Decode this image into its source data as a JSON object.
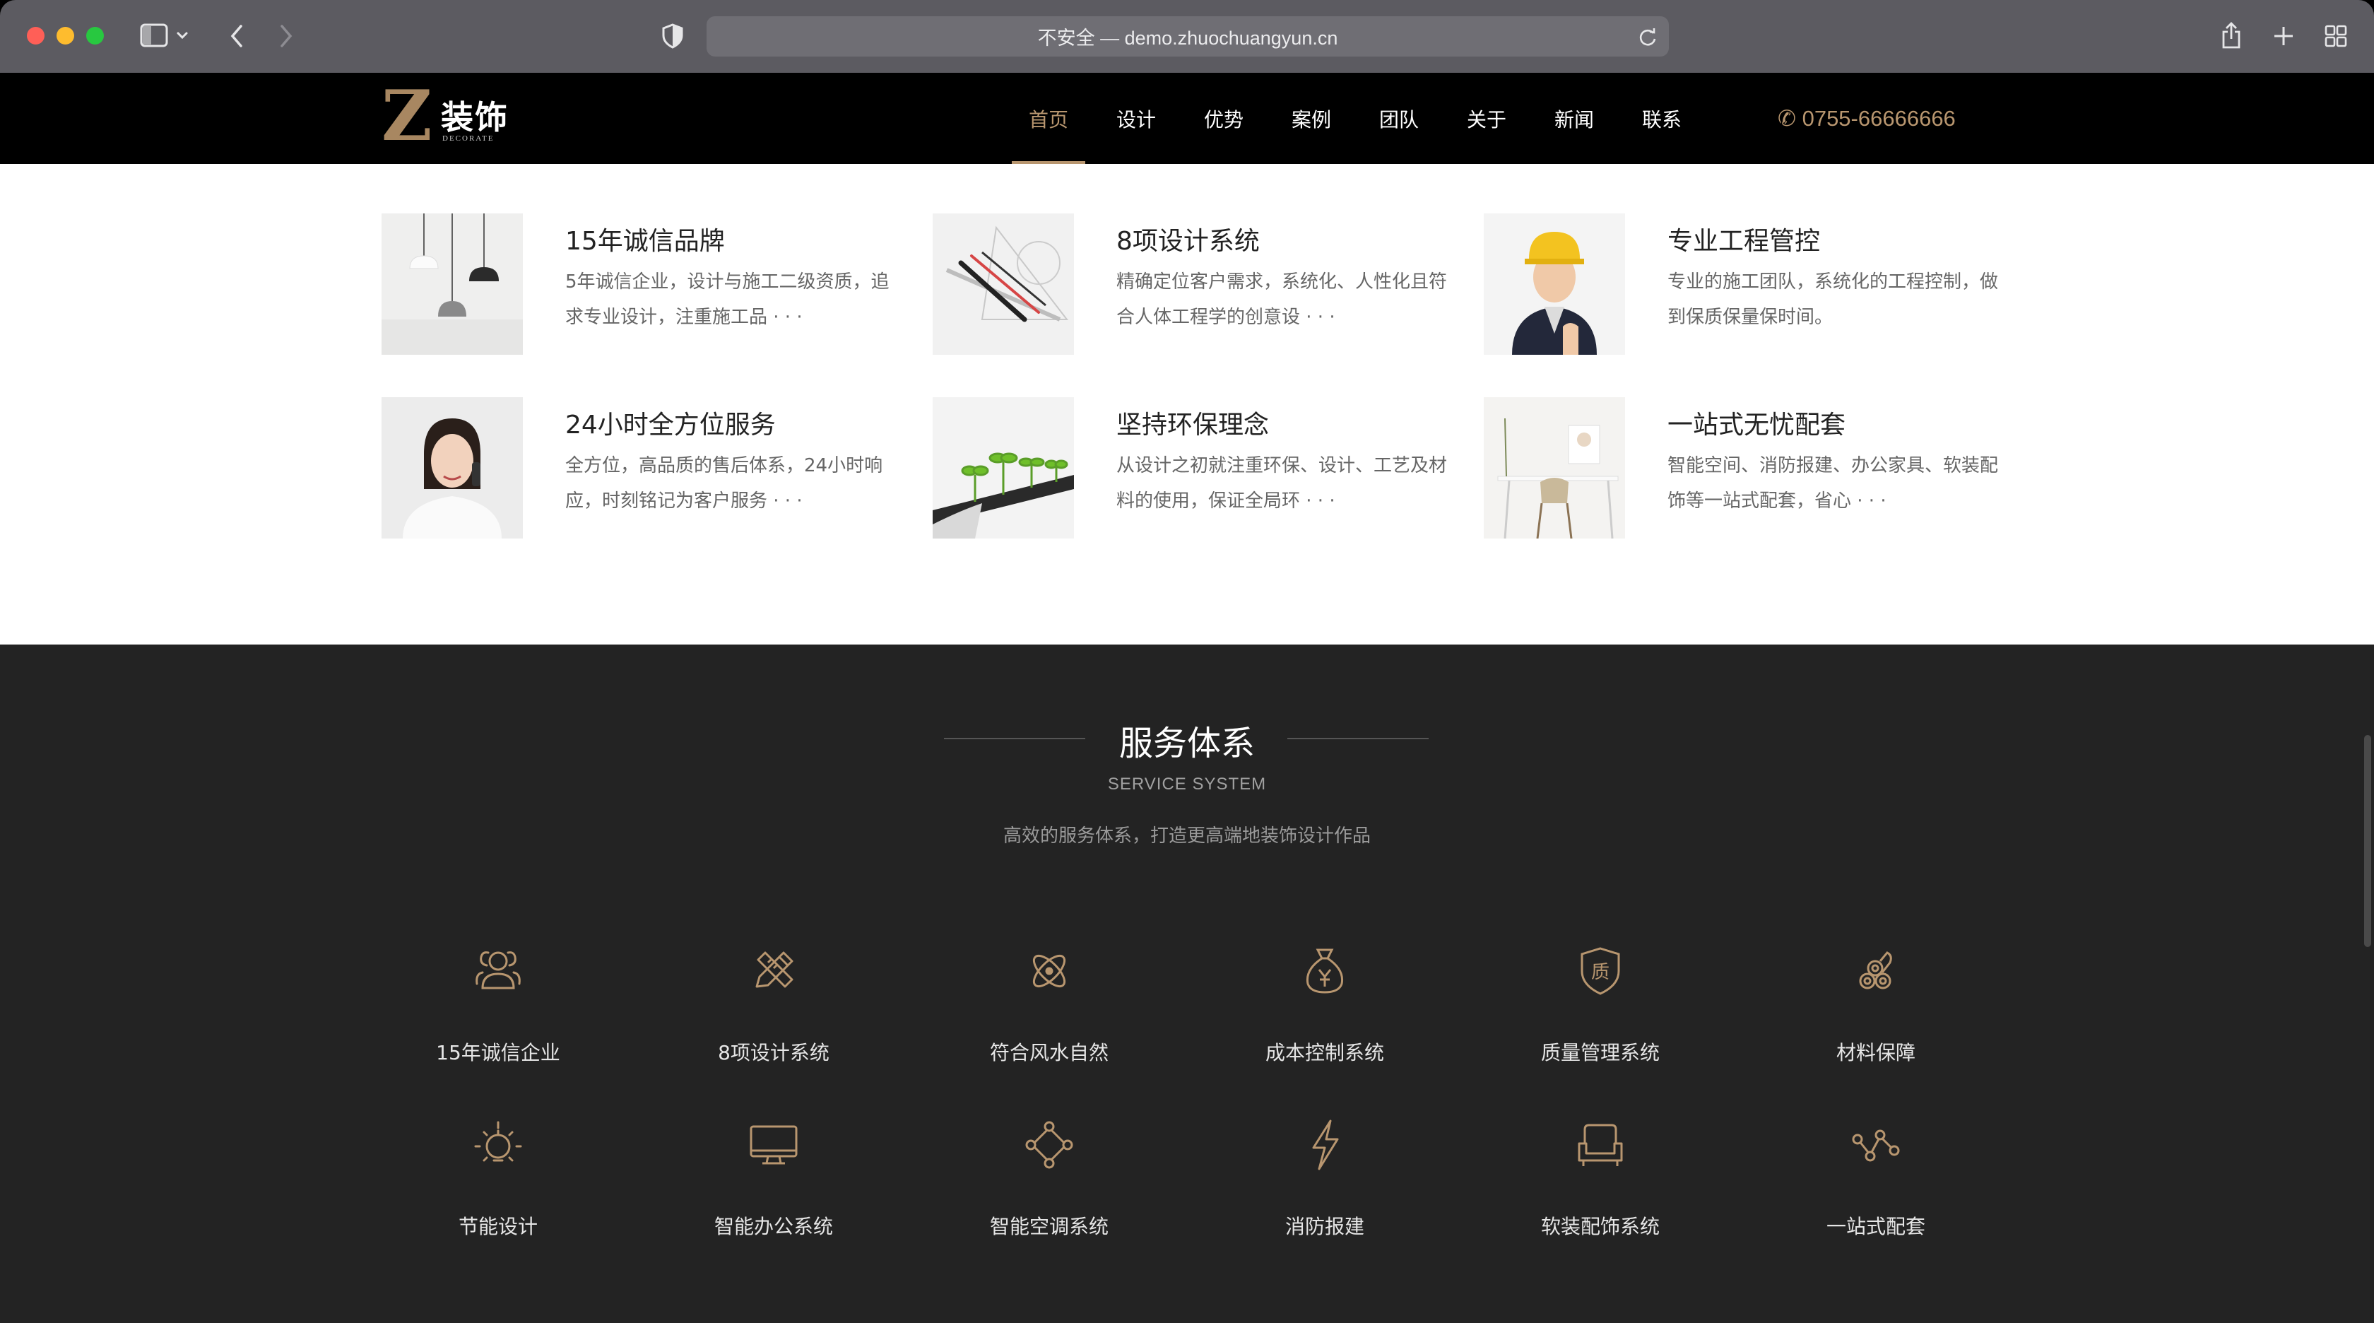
{
  "browser": {
    "url_text": "不安全 — demo.zhuochuangyun.cn"
  },
  "header": {
    "logo": {
      "letter": "Z",
      "cn": "装饰",
      "en": "DECORATE"
    },
    "nav": [
      {
        "label": "首页",
        "active": true
      },
      {
        "label": "设计"
      },
      {
        "label": "优势"
      },
      {
        "label": "案例"
      },
      {
        "label": "团队"
      },
      {
        "label": "关于"
      },
      {
        "label": "新闻"
      },
      {
        "label": "联系"
      }
    ],
    "phone": "✆ 0755-66666666"
  },
  "features": [
    {
      "title": "15年诚信品牌",
      "desc": "5年诚信企业，设计与施工二级资质，追求专业设计，注重施工品 · · ·",
      "image": "pendant-lamps"
    },
    {
      "title": "8项设计系统",
      "desc": "精确定位客户需求，系统化、人性化且符合人体工程学的创意设 · · ·",
      "image": "drafting-tools"
    },
    {
      "title": "专业工程管控",
      "desc": "专业的施工团队，系统化的工程控制，做到保质保量保时间。",
      "image": "construction-worker"
    },
    {
      "title": "24小时全方位服务",
      "desc": "全方位，高品质的售后体系，24小时响应，时刻铭记为客户服务 · · ·",
      "image": "service-woman"
    },
    {
      "title": "坚持环保理念",
      "desc": "从设计之初就注重环保、设计、工艺及材料的使用，保证全局环 · · ·",
      "image": "seedlings"
    },
    {
      "title": "一站式无忧配套",
      "desc": "智能空间、消防报建、办公家具、软装配饰等一站式配套，省心 · · ·",
      "image": "desk-chair"
    }
  ],
  "service": {
    "title": "服务体系",
    "subtitle": "SERVICE SYSTEM",
    "desc": "高效的服务体系，打造更高端地装饰设计作品",
    "items": [
      {
        "label": "15年诚信企业",
        "icon": "users-icon"
      },
      {
        "label": "8项设计系统",
        "icon": "pencil-ruler-icon"
      },
      {
        "label": "符合风水自然",
        "icon": "atom-icon"
      },
      {
        "label": "成本控制系统",
        "icon": "money-bag-icon"
      },
      {
        "label": "质量管理系统",
        "icon": "quality-badge-icon"
      },
      {
        "label": "材料保障",
        "icon": "pipes-icon"
      },
      {
        "label": "节能设计",
        "icon": "bulb-icon"
      },
      {
        "label": "智能办公系统",
        "icon": "monitor-icon"
      },
      {
        "label": "智能空调系统",
        "icon": "network-nodes-icon"
      },
      {
        "label": "消防报建",
        "icon": "lightning-icon"
      },
      {
        "label": "软装配饰系统",
        "icon": "sofa-icon"
      },
      {
        "label": "一站式配套",
        "icon": "share-nodes-icon"
      }
    ]
  },
  "colors": {
    "accent": "#b8966f",
    "header_bg": "#000000",
    "service_bg": "#232323"
  }
}
